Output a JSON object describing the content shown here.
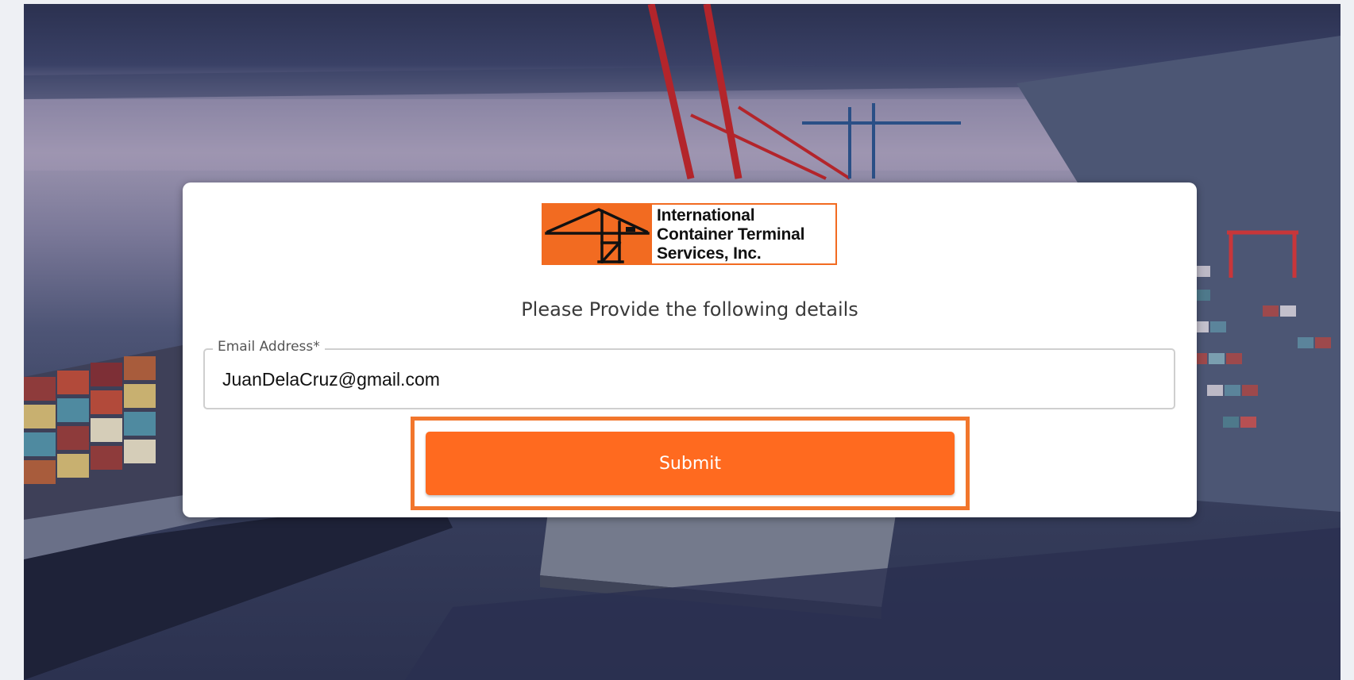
{
  "logo": {
    "lines": [
      "International",
      "Container Terminal",
      "Services, Inc."
    ],
    "brand_color": "#f26b21"
  },
  "form": {
    "prompt": "Please Provide the following details",
    "email": {
      "label": "Email Address*",
      "value": "JuanDelaCruz@gmail.com"
    },
    "submit_label": "Submit"
  },
  "colors": {
    "submit_button": "#ff6a1f",
    "highlight_border": "#f2762c"
  }
}
